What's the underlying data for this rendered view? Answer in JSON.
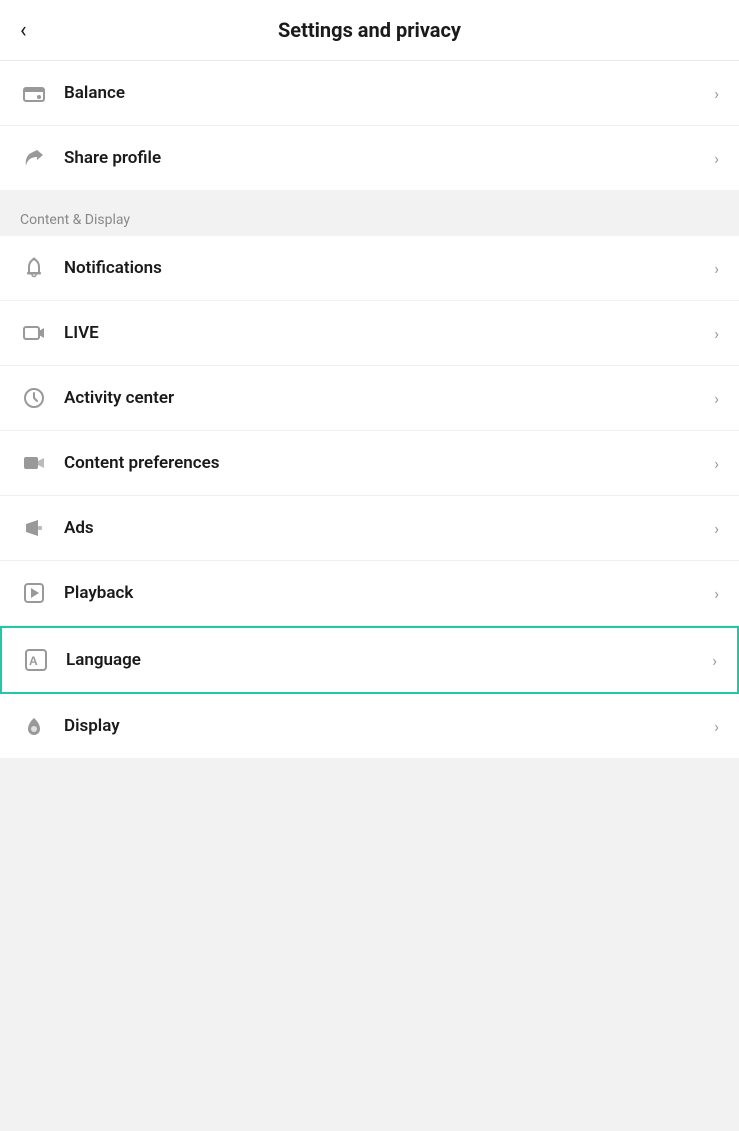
{
  "header": {
    "back_label": "<",
    "title": "Settings and privacy"
  },
  "sections": [
    {
      "id": "top-section",
      "label": null,
      "items": [
        {
          "id": "balance",
          "label": "Balance",
          "icon": "wallet-icon",
          "highlighted": false
        },
        {
          "id": "share-profile",
          "label": "Share profile",
          "icon": "share-icon",
          "highlighted": false
        }
      ]
    },
    {
      "id": "content-display-section",
      "label": "Content & Display",
      "items": [
        {
          "id": "notifications",
          "label": "Notifications",
          "icon": "bell-icon",
          "highlighted": false
        },
        {
          "id": "live",
          "label": "LIVE",
          "icon": "live-icon",
          "highlighted": false
        },
        {
          "id": "activity-center",
          "label": "Activity center",
          "icon": "clock-icon",
          "highlighted": false
        },
        {
          "id": "content-preferences",
          "label": "Content preferences",
          "icon": "video-icon",
          "highlighted": false
        },
        {
          "id": "ads",
          "label": "Ads",
          "icon": "ads-icon",
          "highlighted": false
        },
        {
          "id": "playback",
          "label": "Playback",
          "icon": "playback-icon",
          "highlighted": false
        },
        {
          "id": "language",
          "label": "Language",
          "icon": "language-icon",
          "highlighted": true
        },
        {
          "id": "display",
          "label": "Display",
          "icon": "display-icon",
          "highlighted": false
        }
      ]
    }
  ],
  "chevron": ">",
  "accent_color": "#20c8a8"
}
